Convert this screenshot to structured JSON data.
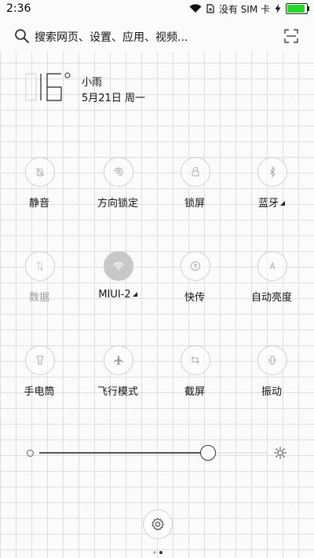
{
  "status_bar": {
    "time": "2:36",
    "carrier": "没有 SIM 卡",
    "battery_level": 0.9
  },
  "search": {
    "placeholder": "搜索网页、设置、应用、视频..."
  },
  "weather": {
    "temperature": "16",
    "degree_symbol": "°",
    "condition": "小雨",
    "date": "5月21日 周一"
  },
  "toggles": [
    {
      "label": "静音",
      "icon": "bell-icon",
      "active": false,
      "dim": false
    },
    {
      "label": "方向锁定",
      "icon": "rotation-lock-icon",
      "active": false,
      "dim": false
    },
    {
      "label": "锁屏",
      "icon": "lock-icon",
      "active": false,
      "dim": false
    },
    {
      "label": "蓝牙",
      "icon": "bluetooth-icon",
      "active": false,
      "dim": false,
      "has_menu": true
    },
    {
      "label": "数据",
      "icon": "mobile-data-icon",
      "active": false,
      "dim": true
    },
    {
      "label": "MIUI-2",
      "icon": "wifi-icon",
      "active": true,
      "dim": false,
      "has_menu": true
    },
    {
      "label": "快传",
      "icon": "quick-transfer-icon",
      "active": false,
      "dim": false
    },
    {
      "label": "自动亮度",
      "icon": "auto-brightness-icon",
      "active": false,
      "dim": false
    },
    {
      "label": "手电筒",
      "icon": "flashlight-icon",
      "active": false,
      "dim": false
    },
    {
      "label": "飞行模式",
      "icon": "airplane-icon",
      "active": false,
      "dim": false
    },
    {
      "label": "截屏",
      "icon": "screenshot-icon",
      "active": false,
      "dim": false
    },
    {
      "label": "振动",
      "icon": "vibrate-icon",
      "active": false,
      "dim": false
    }
  ],
  "brightness": {
    "level": 0.74
  },
  "page_indicator": {
    "count": 2,
    "current": 1
  },
  "colors": {
    "battery_fill": "#2bd62b",
    "active_toggle": "#c8c8c8",
    "grid_line": "#dedede"
  }
}
